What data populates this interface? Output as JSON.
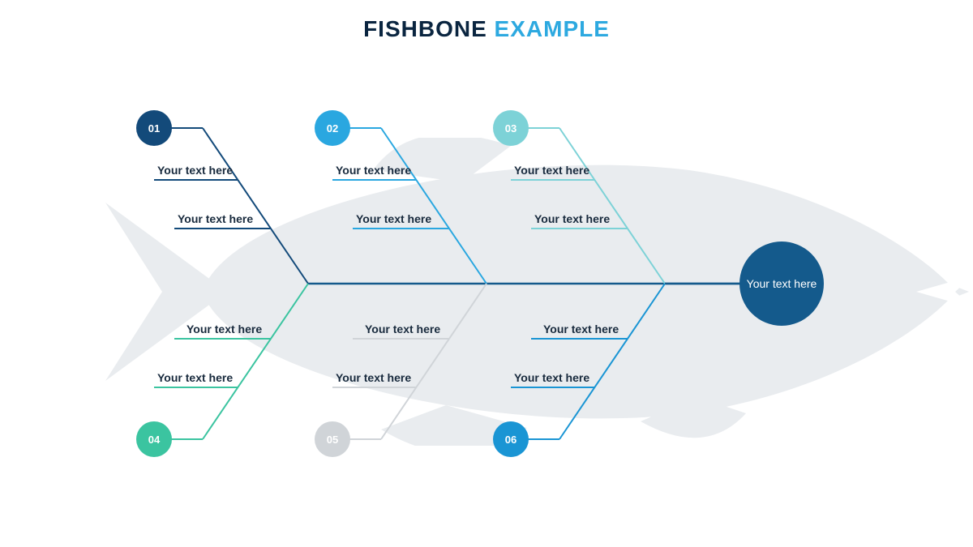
{
  "title": {
    "word1": "FISHBONE",
    "word2": "EXAMPLE"
  },
  "head": {
    "text": "Your text here"
  },
  "branches": [
    {
      "num": "01",
      "color": "#134a7a",
      "sub1": "Your text here",
      "sub2": "Your text here",
      "text_color": "#182a3d"
    },
    {
      "num": "02",
      "color": "#2aa7e0",
      "sub1": "Your text here",
      "sub2": "Your text here",
      "text_color": "#156f99"
    },
    {
      "num": "03",
      "color": "#7dd2d7",
      "sub1": "Your text here",
      "sub2": "Your text here",
      "text_color": "#156f99"
    },
    {
      "num": "04",
      "color": "#3bc4a0",
      "sub1": "Your text here",
      "sub2": "Your text here",
      "text_color": "#182a3d"
    },
    {
      "num": "05",
      "color": "#d0d4d8",
      "sub1": "Your text here",
      "sub2": "Your text here",
      "text_color": "#182a3d"
    },
    {
      "num": "06",
      "color": "#1a95d4",
      "sub1": "Your text here",
      "sub2": "Your text here",
      "text_color": "#156f99"
    }
  ],
  "colors": {
    "spine": "#145a8c",
    "fish_fill": "#e9ecef"
  }
}
